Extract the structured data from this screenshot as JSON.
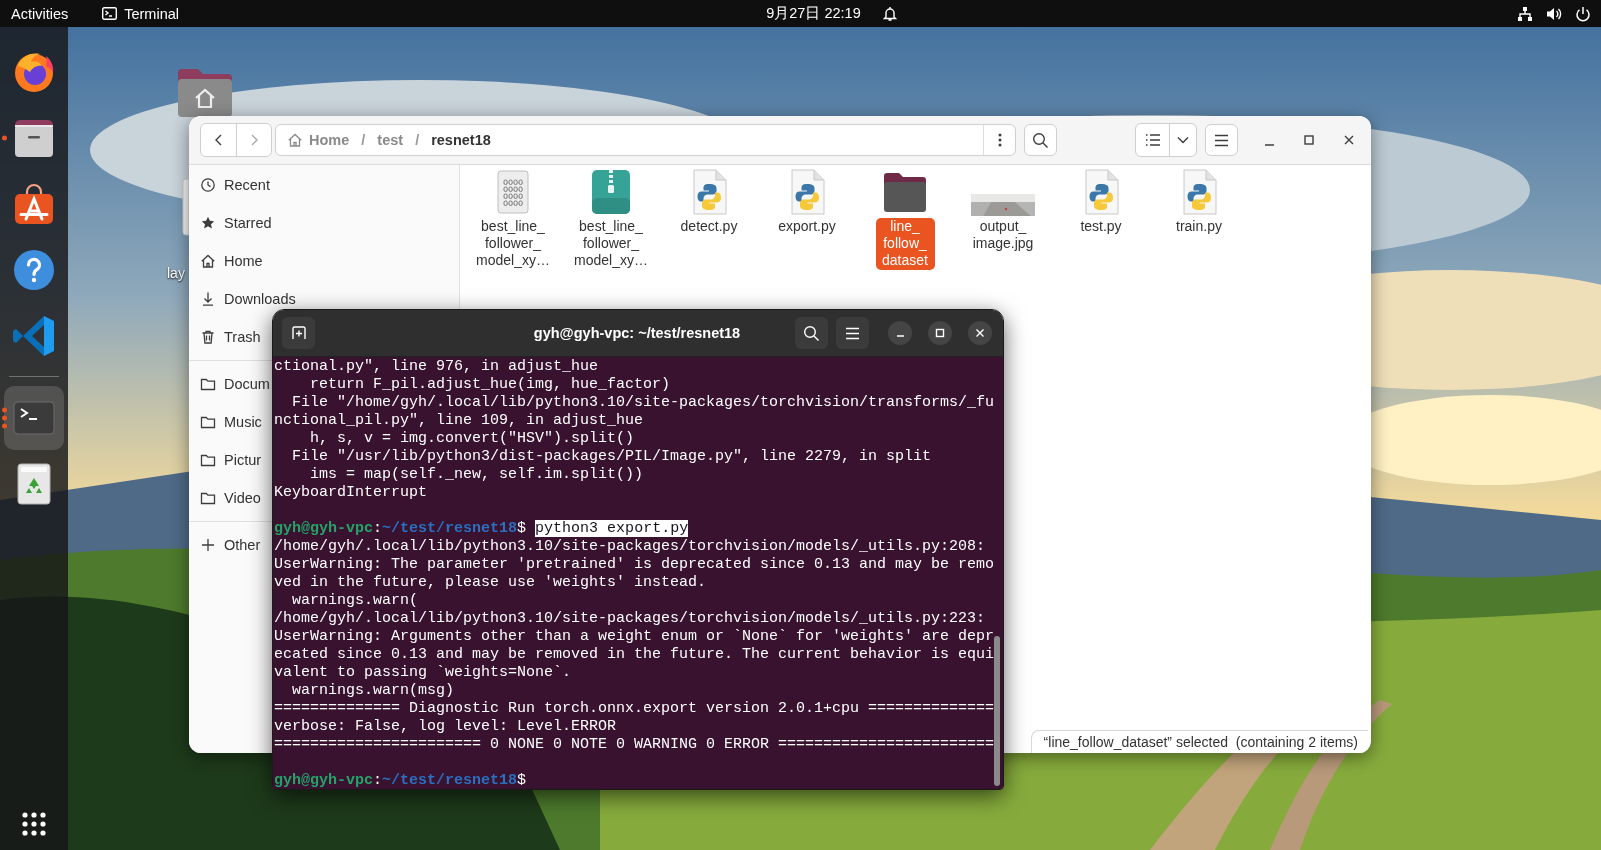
{
  "top_bar": {
    "activities": "Activities",
    "app_name": "Terminal",
    "clock": "9月27日  22:19"
  },
  "dock": {
    "items": [
      {
        "kind": "browser",
        "running": false,
        "active": false
      },
      {
        "kind": "files",
        "running": true,
        "multiple": false,
        "active": false
      },
      {
        "kind": "software",
        "running": false,
        "active": false
      },
      {
        "kind": "help",
        "running": false,
        "active": false
      },
      {
        "kind": "editor",
        "running": false,
        "active": false
      },
      {
        "kind": "terminal",
        "running": true,
        "multiple": true,
        "active": true
      },
      {
        "kind": "trash",
        "running": false,
        "active": false
      }
    ]
  },
  "desktop": {
    "items": [
      {
        "kind": "home_folder"
      },
      {
        "kind": "file",
        "label": "lay"
      }
    ]
  },
  "files_window": {
    "path": {
      "separator": "/",
      "crumbs": [
        {
          "label": "Home",
          "kind": "home",
          "current": false
        },
        {
          "label": "test",
          "current": false
        },
        {
          "label": "resnet18",
          "current": true
        }
      ]
    },
    "sidebar": {
      "sections": [
        [
          {
            "label": "Recent",
            "kind": "recent"
          },
          {
            "label": "Starred",
            "kind": "starred"
          },
          {
            "label": "Home",
            "kind": "home"
          },
          {
            "label": "Downloads",
            "kind": "downloads"
          },
          {
            "label": "Trash",
            "kind": "trash"
          }
        ],
        [
          {
            "label": "Docum",
            "kind": "folder"
          },
          {
            "label": "Music",
            "kind": "folder"
          },
          {
            "label": "Pictur",
            "kind": "folder"
          },
          {
            "label": "Video",
            "kind": "folder"
          }
        ],
        [
          {
            "label": "Other",
            "kind": "other"
          }
        ]
      ]
    },
    "files": [
      {
        "name": "best_line_follower_model_xy…",
        "kind": "binary",
        "selected": false
      },
      {
        "name": "best_line_follower_model_xy…",
        "kind": "zip",
        "selected": false
      },
      {
        "name": "detect.py",
        "kind": "python",
        "selected": false
      },
      {
        "name": "export.py",
        "kind": "python",
        "selected": false
      },
      {
        "name": "line_follow_dataset",
        "kind": "folder",
        "selected": true
      },
      {
        "name": "output_image.jpg",
        "selected": false
      },
      {
        "name": "test.py",
        "kind": "python",
        "selected": false
      },
      {
        "name": "train.py",
        "kind": "python",
        "selected": false
      }
    ],
    "status": "“line_follow_dataset” selected  (containing 2 items)"
  },
  "terminal_window": {
    "title": "gyh@gyh-vpc: ~/test/resnet18",
    "lines": [
      {
        "kind": "output",
        "text": "ctional.py\", line 976, in adjust_hue"
      },
      {
        "kind": "output",
        "text": "    return F_pil.adjust_hue(img, hue_factor)"
      },
      {
        "kind": "output",
        "text": "  File \"/home/gyh/.local/lib/python3.10/site-packages/torchvision/transforms/_fu"
      },
      {
        "kind": "output",
        "text": "nctional_pil.py\", line 109, in adjust_hue"
      },
      {
        "kind": "output",
        "text": "    h, s, v = img.convert(\"HSV\").split()"
      },
      {
        "kind": "output",
        "text": "  File \"/usr/lib/python3/dist-packages/PIL/Image.py\", line 2279, in split"
      },
      {
        "kind": "output",
        "text": "    ims = map(self._new, self.im.split())"
      },
      {
        "kind": "output",
        "text": "KeyboardInterrupt"
      },
      {
        "kind": "blank"
      },
      {
        "kind": "prompt",
        "user": "gyh@gyh-vpc",
        "separator": ":",
        "path": "~/test/resnet18",
        "symbol": "$",
        "command": "python3 export.py",
        "highlighted": true
      },
      {
        "kind": "output",
        "text": "/home/gyh/.local/lib/python3.10/site-packages/torchvision/models/_utils.py:208:"
      },
      {
        "kind": "output",
        "text": "UserWarning: The parameter 'pretrained' is deprecated since 0.13 and may be remo"
      },
      {
        "kind": "output",
        "text": "ved in the future, please use 'weights' instead."
      },
      {
        "kind": "output",
        "text": "  warnings.warn("
      },
      {
        "kind": "output",
        "text": "/home/gyh/.local/lib/python3.10/site-packages/torchvision/models/_utils.py:223:"
      },
      {
        "kind": "output",
        "text": "UserWarning: Arguments other than a weight enum or `None` for 'weights' are depr"
      },
      {
        "kind": "output",
        "text": "ecated since 0.13 and may be removed in the future. The current behavior is equi"
      },
      {
        "kind": "output",
        "text": "valent to passing `weights=None`."
      },
      {
        "kind": "output",
        "text": "  warnings.warn(msg)"
      },
      {
        "kind": "output",
        "text": "============== Diagnostic Run torch.onnx.export version 2.0.1+cpu =============="
      },
      {
        "kind": "output",
        "text": "verbose: False, log level: Level.ERROR"
      },
      {
        "kind": "output",
        "text": "======================= 0 NONE 0 NOTE 0 WARNING 0 ERROR ========================"
      },
      {
        "kind": "blank"
      },
      {
        "kind": "prompt",
        "user": "gyh@gyh-vpc",
        "separator": ":",
        "path": "~/test/resnet18",
        "symbol": "$"
      }
    ]
  }
}
